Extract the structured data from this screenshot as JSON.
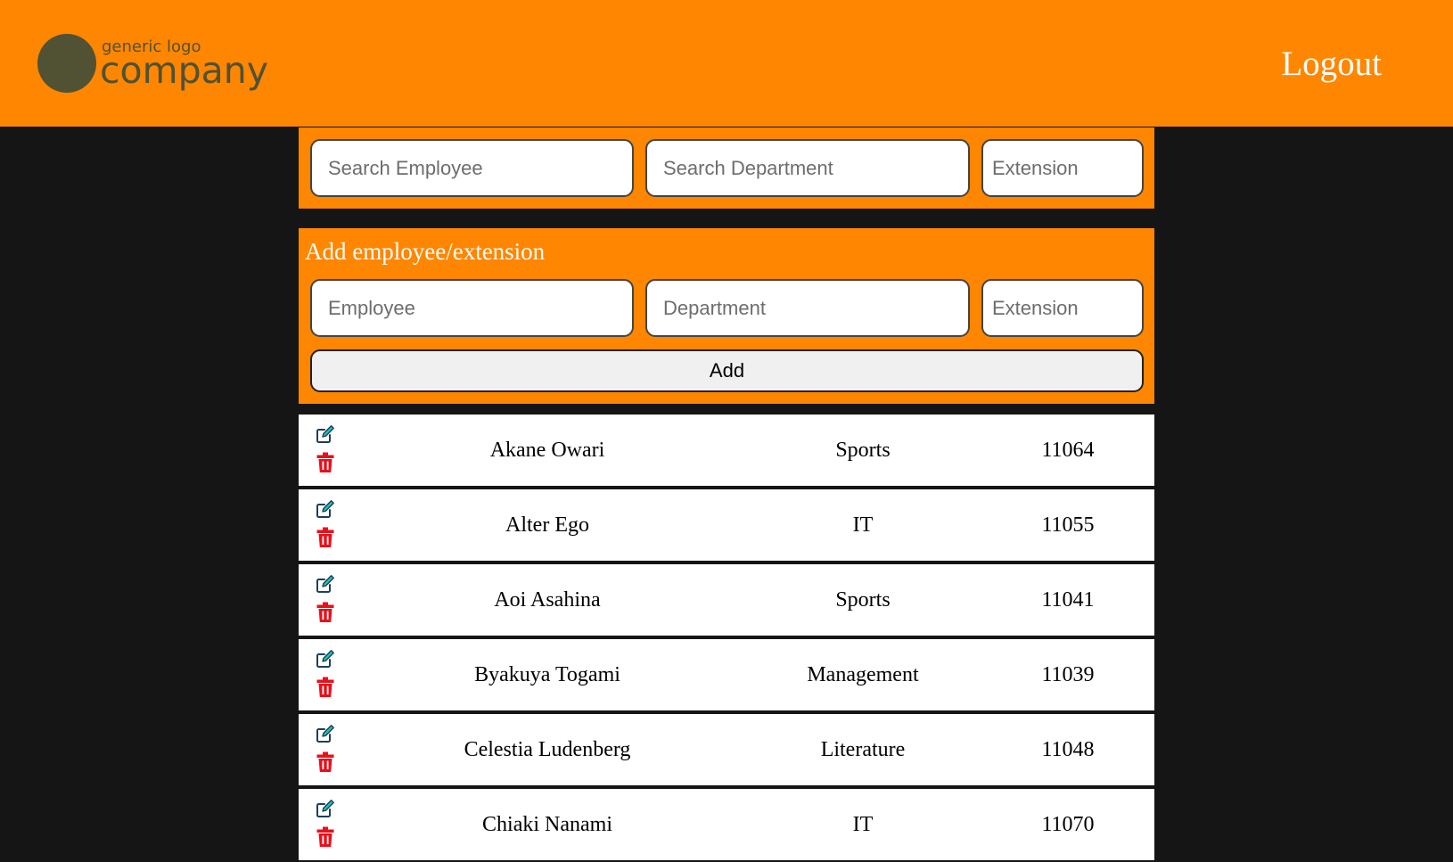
{
  "header": {
    "logo_small": "generic logo",
    "logo_big": "company",
    "logout_label": "Logout",
    "brand_color": "#ff8600",
    "logo_color": "#515134"
  },
  "search": {
    "employee_placeholder": "Search Employee",
    "department_placeholder": "Search Department",
    "extension_placeholder": "Extension"
  },
  "add_form": {
    "title": "Add employee/extension",
    "employee_placeholder": "Employee",
    "department_placeholder": "Department",
    "extension_placeholder": "Extension",
    "add_label": "Add"
  },
  "employees": [
    {
      "name": "Akane Owari",
      "department": "Sports",
      "extension": "11064"
    },
    {
      "name": "Alter Ego",
      "department": "IT",
      "extension": "11055"
    },
    {
      "name": "Aoi Asahina",
      "department": "Sports",
      "extension": "11041"
    },
    {
      "name": "Byakuya Togami",
      "department": "Management",
      "extension": "11039"
    },
    {
      "name": "Celestia Ludenberg",
      "department": "Literature",
      "extension": "11048"
    },
    {
      "name": "Chiaki Nanami",
      "department": "IT",
      "extension": "11070"
    }
  ],
  "icons": {
    "edit": "edit-icon",
    "delete": "trash-icon",
    "edit_color": "#0e8c8c",
    "delete_color": "#e8101b"
  }
}
